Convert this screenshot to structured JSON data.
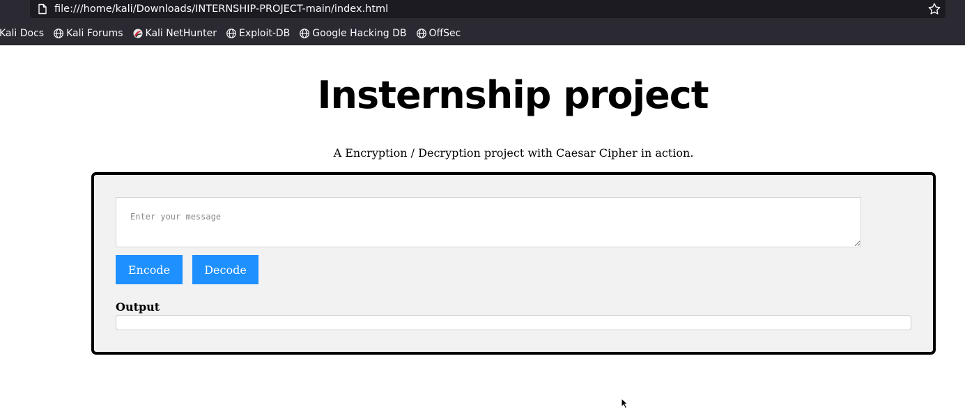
{
  "browser": {
    "url": "file:///home/kali/Downloads/INTERNSHIP-PROJECT-main/index.html",
    "bookmarks": [
      {
        "label": "Kali Docs",
        "icon": "none"
      },
      {
        "label": "Kali Forums",
        "icon": "globe-icon"
      },
      {
        "label": "Kali NetHunter",
        "icon": "nethunter-icon"
      },
      {
        "label": "Exploit-DB",
        "icon": "globe-icon"
      },
      {
        "label": "Google Hacking DB",
        "icon": "globe-icon"
      },
      {
        "label": "OffSec",
        "icon": "globe-icon"
      }
    ]
  },
  "page": {
    "title": "Insternship project",
    "subtitle": "A Encryption / Decryption project with Caesar Cipher in action.",
    "message_placeholder": "Enter your message",
    "message_value": "",
    "encode_label": "Encode",
    "decode_label": "Decode",
    "output_label": "Output",
    "output_value": ""
  },
  "colors": {
    "chrome_bg": "#2b2a33",
    "urlbar_bg": "#1c1b22",
    "button_bg": "#1e90ff",
    "box_bg": "#f2f2f2",
    "box_border": "#000000"
  }
}
